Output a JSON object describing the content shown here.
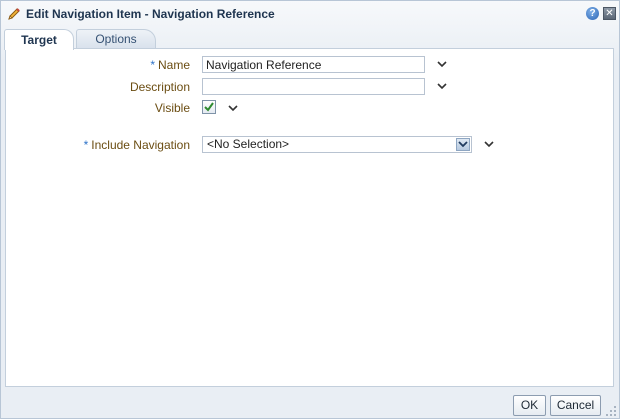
{
  "dialog": {
    "title": "Edit Navigation Item - Navigation Reference",
    "help_label": "?",
    "close_label": "✕"
  },
  "tabs": [
    {
      "label": "Target",
      "selected": true
    },
    {
      "label": "Options",
      "selected": false
    }
  ],
  "form": {
    "name": {
      "label": "Name",
      "required": true,
      "value": "Navigation Reference"
    },
    "description": {
      "label": "Description",
      "required": false,
      "value": ""
    },
    "visible": {
      "label": "Visible",
      "checked": true
    },
    "include_navigation": {
      "label": "Include Navigation",
      "required": true,
      "value": "<No Selection>"
    },
    "required_marker": "*"
  },
  "footer": {
    "ok_label": "OK",
    "cancel_label": "Cancel"
  },
  "colors": {
    "label": "#6b4d12",
    "required_marker": "#2d72c8",
    "title": "#1f3550",
    "border": "#c3cfdc"
  }
}
